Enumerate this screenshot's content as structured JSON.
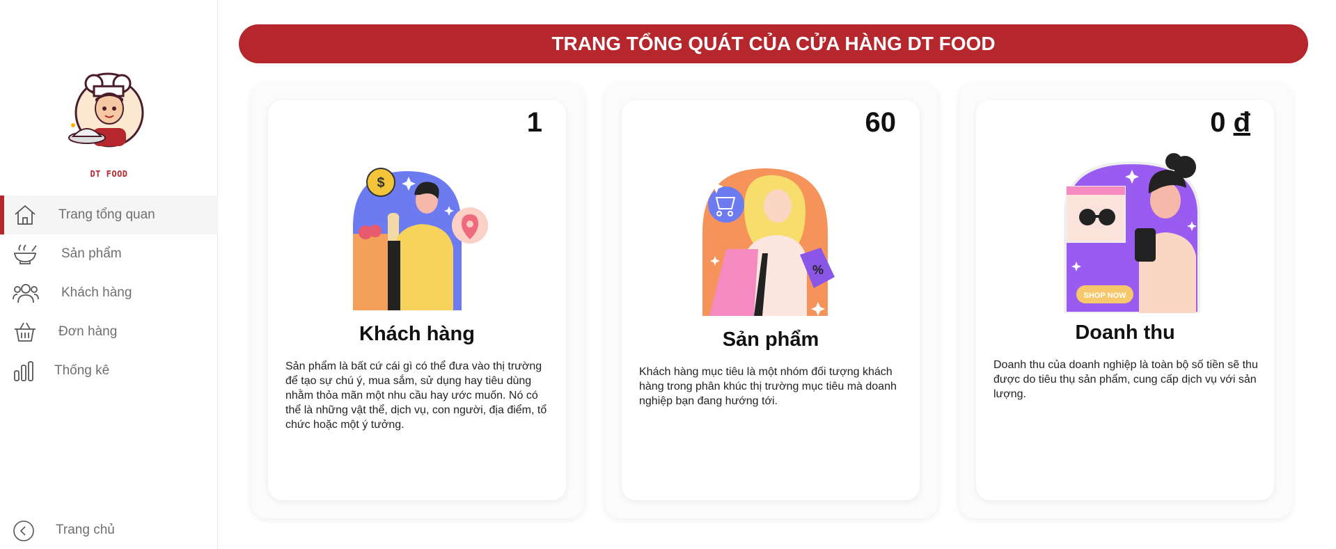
{
  "brand": {
    "name": "DT FOOD",
    "accent": "#b5262d"
  },
  "header": {
    "title": "TRANG TỔNG QUÁT CỦA CỬA HÀNG DT FOOD"
  },
  "sidebar": {
    "items": [
      {
        "label": "Trang tổng quan",
        "icon": "home-icon",
        "active": true
      },
      {
        "label": "Sản phẩm",
        "icon": "food-bowl-icon",
        "active": false
      },
      {
        "label": "Khách hàng",
        "icon": "users-icon",
        "active": false
      },
      {
        "label": "Đơn hàng",
        "icon": "basket-icon",
        "active": false
      },
      {
        "label": "Thống kê",
        "icon": "bar-chart-icon",
        "active": false
      }
    ],
    "footer": {
      "label": "Trang chủ",
      "icon": "chevron-left-circle-icon"
    }
  },
  "cards": [
    {
      "value": "1",
      "title": "Khách hàng",
      "description": "Sản phẩm là bất cứ cái gì có thể đưa vào thị trường để tạo sự chú ý, mua sắm, sử dụng hay tiêu dùng nhằm thỏa mãn một nhu cầu hay ước muốn. Nó có thể là những vật thể, dịch vụ, con người, địa điểm, tổ chức hoặc một ý tưởng."
    },
    {
      "value": "60",
      "title": "Sản phẩm",
      "description": "Khách hàng mục tiêu là một nhóm đối tượng khách hàng trong phân khúc thị trường mục tiêu mà doanh nghiệp bạn đang hướng tới."
    },
    {
      "value": "0",
      "unit": "đ",
      "title": "Doanh thu",
      "description": "Doanh thu của doanh nghiệp là toàn bộ số tiền sẽ thu được do tiêu thụ sản phẩm, cung cấp dịch vụ với sản lượng.",
      "badge": "SHOP NOW"
    }
  ]
}
